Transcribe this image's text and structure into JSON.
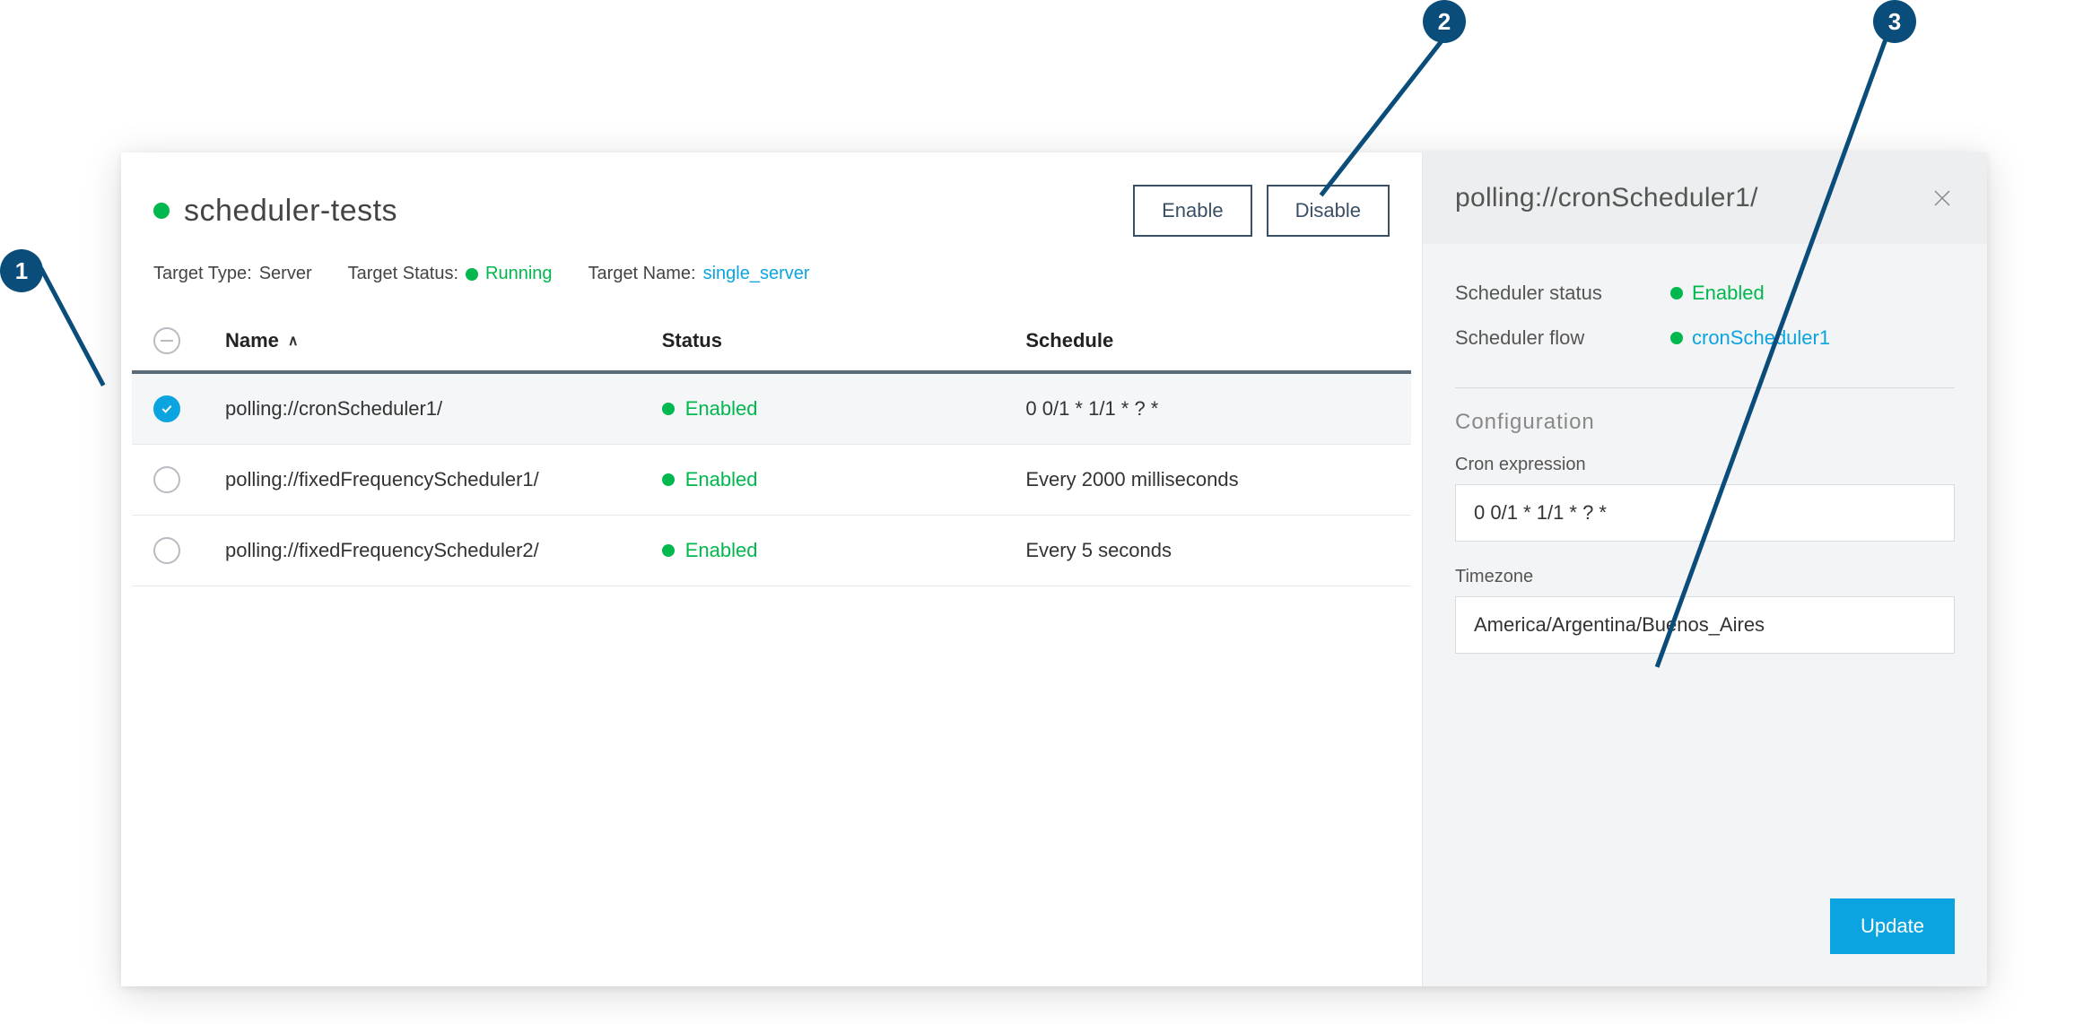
{
  "callouts": {
    "c1": "1",
    "c2": "2",
    "c3": "3"
  },
  "header": {
    "title": "scheduler-tests",
    "enable_label": "Enable",
    "disable_label": "Disable"
  },
  "meta": {
    "target_type_label": "Target Type:",
    "target_type_value": "Server",
    "target_status_label": "Target Status:",
    "target_status_value": "Running",
    "target_name_label": "Target Name:",
    "target_name_value": "single_server"
  },
  "columns": {
    "name": "Name",
    "status": "Status",
    "schedule": "Schedule"
  },
  "rows": [
    {
      "name": "polling://cronScheduler1/",
      "status": "Enabled",
      "schedule": "0 0/1 * 1/1 * ? *",
      "selected": true
    },
    {
      "name": "polling://fixedFrequencyScheduler1/",
      "status": "Enabled",
      "schedule": "Every 2000 milliseconds",
      "selected": false
    },
    {
      "name": "polling://fixedFrequencyScheduler2/",
      "status": "Enabled",
      "schedule": "Every 5 seconds",
      "selected": false
    }
  ],
  "panel": {
    "title": "polling://cronScheduler1/",
    "scheduler_status_label": "Scheduler status",
    "scheduler_status_value": "Enabled",
    "scheduler_flow_label": "Scheduler flow",
    "scheduler_flow_value": "cronScheduler1",
    "configuration_title": "Configuration",
    "cron_label": "Cron expression",
    "cron_value": "0 0/1 * 1/1 * ? *",
    "timezone_label": "Timezone",
    "timezone_value": "America/Argentina/Buenos_Aires",
    "update_label": "Update"
  }
}
